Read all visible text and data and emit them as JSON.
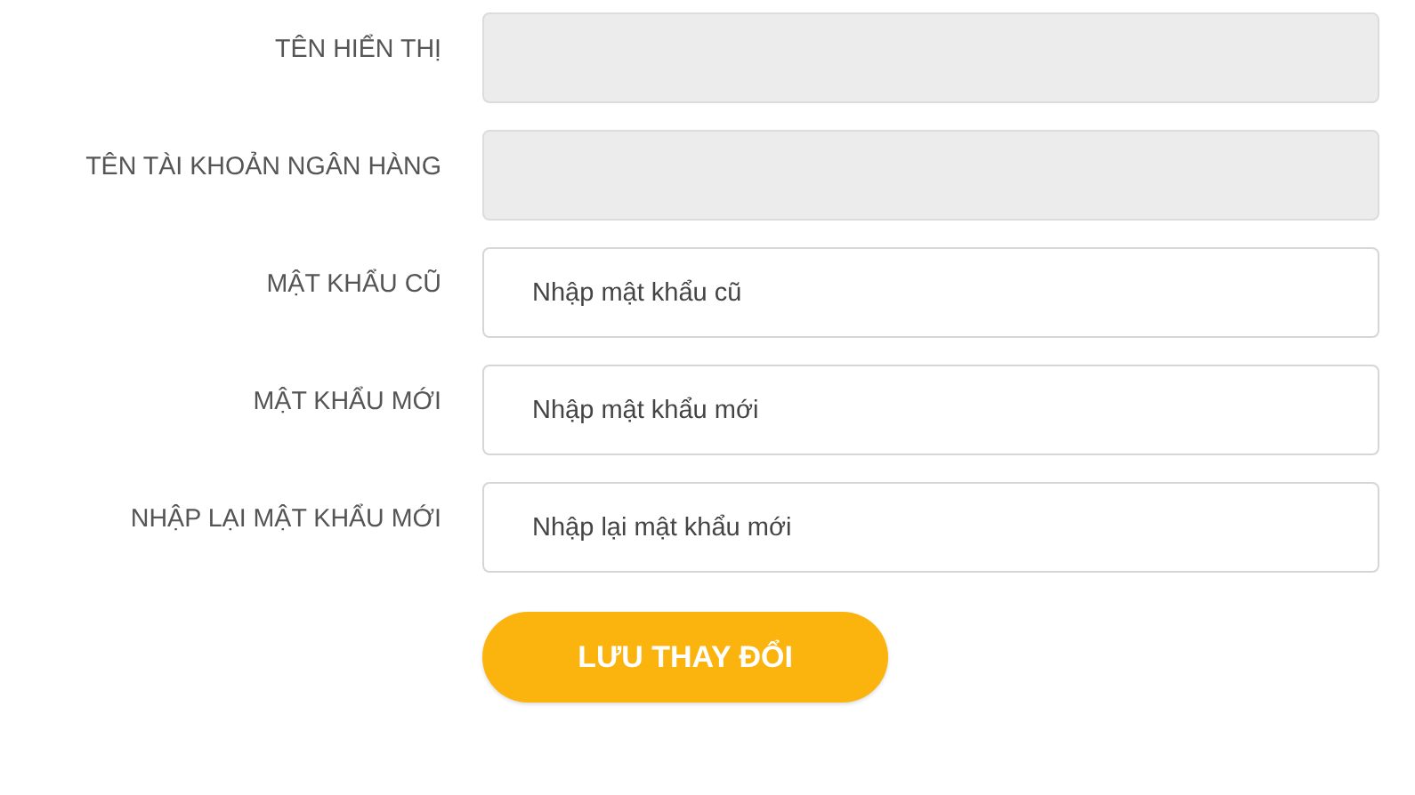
{
  "fields": [
    {
      "label": "TÊN HIỂN THỊ",
      "disabled": true
    },
    {
      "label": "TÊN TÀI KHOẢN NGÂN HÀNG",
      "disabled": true
    },
    {
      "label": "MẬT KHẨU CŨ",
      "disabled": false,
      "placeholder": "Nhập mật khẩu cũ"
    },
    {
      "label": "MẬT KHẨU MỚI",
      "disabled": false,
      "placeholder": "Nhập mật khẩu mới"
    },
    {
      "label": "NHẬP LẠI MẬT KHẨU MỚI",
      "disabled": false,
      "placeholder": "Nhập lại mật khẩu mới"
    }
  ],
  "save_button": {
    "label": "LƯU THAY ĐỔI"
  }
}
